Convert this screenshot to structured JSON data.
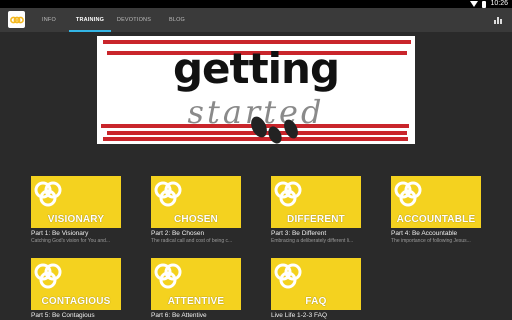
{
  "status": {
    "time": "10:26"
  },
  "tabs": [
    {
      "label": "INFO",
      "active": false
    },
    {
      "label": "TRAINING",
      "active": true
    },
    {
      "label": "DEVOTIONS",
      "active": false
    },
    {
      "label": "BLOG",
      "active": false
    }
  ],
  "banner": {
    "line1": "getting",
    "line2": "started"
  },
  "cards": [
    {
      "thumb": "VISIONARY",
      "title": "Part 1: Be Visionary",
      "subtitle": "Catching God's vision for You and..."
    },
    {
      "thumb": "CHOSEN",
      "title": "Part 2: Be Chosen",
      "subtitle": "The radical call and cost of being c..."
    },
    {
      "thumb": "DIFFERENT",
      "title": "Part 3: Be Different",
      "subtitle": "Embracing a deliberately different li..."
    },
    {
      "thumb": "ACCOUNTABLE",
      "title": "Part 4: Be Accountable",
      "subtitle": "The importance of following Jesus..."
    },
    {
      "thumb": "CONTAGIOUS",
      "title": "Part 5: Be Contagious",
      "subtitle": ""
    },
    {
      "thumb": "ATTENTIVE",
      "title": "Part 6: Be Attentive",
      "subtitle": ""
    },
    {
      "thumb": "FAQ",
      "title": "Live Life 1-2-3 FAQ",
      "subtitle": ""
    }
  ],
  "colors": {
    "accent": "#33b5e5",
    "thumb": "#f4d21f",
    "stripe": "#c9252b"
  }
}
